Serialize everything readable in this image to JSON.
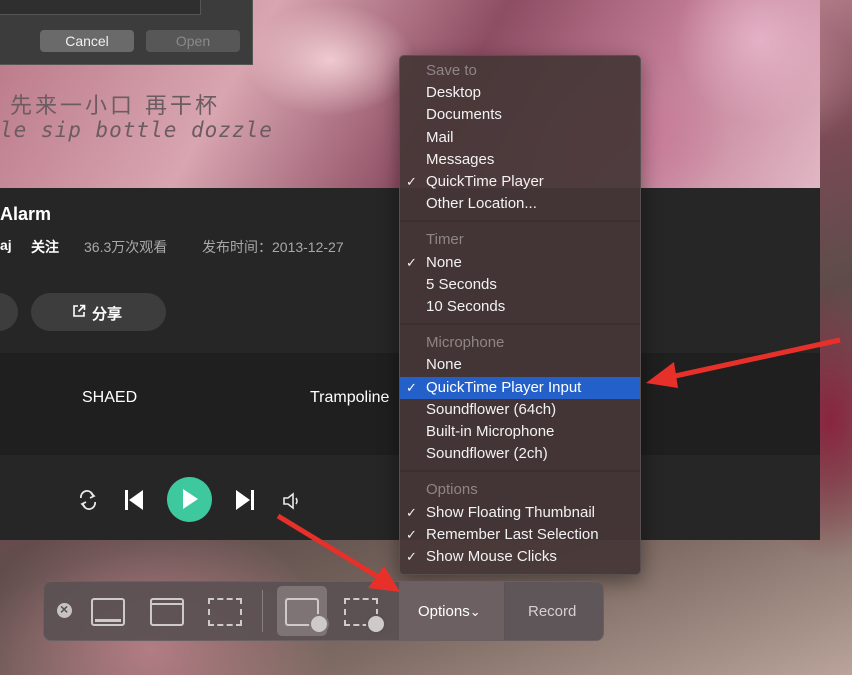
{
  "dialog": {
    "cancel_label": "Cancel",
    "open_label": "Open"
  },
  "video": {
    "subtitle_cn": "先来一小口 再干杯",
    "subtitle_en": "le sip bottle dozzle"
  },
  "song": {
    "title": "Alarm",
    "artist_fragment": "aj",
    "follow_label": "关注",
    "views": "36.3万次观看",
    "publish_date": "发布时间：2013-12-27",
    "share_label": "分享"
  },
  "list": {
    "item1": "SHAED",
    "item2": "Trampoline"
  },
  "menu": {
    "sections": [
      {
        "header": "Save to",
        "items": [
          {
            "label": "Desktop",
            "checked": false
          },
          {
            "label": "Documents",
            "checked": false
          },
          {
            "label": "Mail",
            "checked": false
          },
          {
            "label": "Messages",
            "checked": false
          },
          {
            "label": "QuickTime Player",
            "checked": true
          },
          {
            "label": "Other Location...",
            "checked": false
          }
        ]
      },
      {
        "header": "Timer",
        "items": [
          {
            "label": "None",
            "checked": true
          },
          {
            "label": "5 Seconds",
            "checked": false
          },
          {
            "label": "10 Seconds",
            "checked": false
          }
        ]
      },
      {
        "header": "Microphone",
        "items": [
          {
            "label": "None",
            "checked": false
          },
          {
            "label": "QuickTime Player Input",
            "checked": true,
            "highlighted": true
          },
          {
            "label": "Soundflower (64ch)",
            "checked": false
          },
          {
            "label": "Built-in Microphone",
            "checked": false
          },
          {
            "label": "Soundflower (2ch)",
            "checked": false
          }
        ]
      },
      {
        "header": "Options",
        "items": [
          {
            "label": "Show Floating Thumbnail",
            "checked": true
          },
          {
            "label": "Remember Last Selection",
            "checked": true
          },
          {
            "label": "Show Mouse Clicks",
            "checked": true
          }
        ]
      }
    ],
    "checkmark": "✓",
    "highlight_color": "#2460c9"
  },
  "toolbar": {
    "options_label": "Options",
    "options_chevron": "⌄",
    "record_label": "Record",
    "close_glyph": "×"
  },
  "colors": {
    "play_button": "#3ec89d",
    "arrow": "#e8302a"
  }
}
